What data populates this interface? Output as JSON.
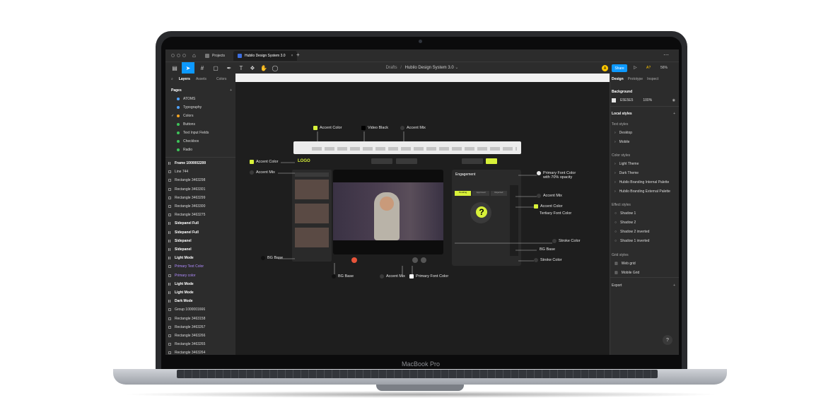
{
  "device": {
    "brand_label": "MacBook Pro"
  },
  "browser": {
    "tabs": [
      {
        "label": "Projects",
        "active": false
      },
      {
        "label": "Hubilo Design System 3.0",
        "active": true
      }
    ]
  },
  "toolbar": {
    "breadcrumb_parent": "Drafts",
    "breadcrumb_separator": "/",
    "file_title": "Hubilo Design System 3.0",
    "avatar_initial": "A",
    "share_label": "Share",
    "ai_label": "A?",
    "zoom": "56%"
  },
  "left_panel": {
    "tabs": [
      "Layers",
      "Assets",
      "Colors"
    ],
    "pages_title": "Pages",
    "pages": [
      {
        "label": "ATOMS",
        "dot": "#4fa3ff"
      },
      {
        "label": "Typography",
        "dot": "#4fa3ff"
      },
      {
        "label": "Colors",
        "dot": "#f6a623",
        "current": true
      },
      {
        "label": "Buttons",
        "dot": "#3ec45a"
      },
      {
        "label": "Text Input Fields",
        "dot": "#3ec45a"
      },
      {
        "label": "Checkbox",
        "dot": "#3ec45a"
      },
      {
        "label": "Radio",
        "dot": "#3ec45a"
      }
    ],
    "layers": [
      {
        "label": "Frame 1000002200",
        "bold": true
      },
      {
        "label": "Line 744"
      },
      {
        "label": "Rectangle 3463298"
      },
      {
        "label": "Rectangle 3463301"
      },
      {
        "label": "Rectangle 3463299"
      },
      {
        "label": "Rectangle 3463300"
      },
      {
        "label": "Rectangle 3463275"
      },
      {
        "label": "Sidepanel Full",
        "bold": true
      },
      {
        "label": "Sidepanel Full",
        "bold": true
      },
      {
        "label": "Sidepanel",
        "bold": true
      },
      {
        "label": "Sidepanel",
        "bold": true
      },
      {
        "label": "Light Mode",
        "bold": true
      },
      {
        "label": "Primary Text Color",
        "purple": true
      },
      {
        "label": "Primary color",
        "purple": true
      },
      {
        "label": "Light Mode",
        "bold": true
      },
      {
        "label": "Light Mode",
        "bold": true
      },
      {
        "label": "Dark Mode",
        "bold": true
      },
      {
        "label": "Group 1000001666"
      },
      {
        "label": "Rectangle 3463158"
      },
      {
        "label": "Rectangle 3463267"
      },
      {
        "label": "Rectangle 3463266"
      },
      {
        "label": "Rectangle 3463265"
      },
      {
        "label": "Rectangle 3463264"
      }
    ]
  },
  "right_panel": {
    "tabs": [
      "Design",
      "Prototype",
      "Inspect"
    ],
    "background_title": "Background",
    "background_hex": "E5E5E5",
    "background_opacity": "100%",
    "local_styles_title": "Local styles",
    "text_styles_title": "Text styles",
    "text_styles": [
      "Desktop",
      "Mobile"
    ],
    "color_styles_title": "Color styles",
    "color_styles": [
      "Light Theme",
      "Dark Theme",
      "Hubilo Branding Internal Palette",
      "Hubilo Branding External Palette"
    ],
    "effect_styles_title": "Effect styles",
    "effect_styles": [
      "Shadow 1",
      "Shadow 2",
      "Shadow 2 inverted",
      "Shadow 1 inverted"
    ],
    "grid_styles_title": "Grid styles",
    "grid_styles": [
      "Web grid",
      "Mobile Grid"
    ],
    "export_title": "Export",
    "help_label": "?"
  },
  "canvas": {
    "annotations": {
      "accent_color_top": "Accent Color",
      "video_black": "Video Black",
      "accent_mix_top": "Accent Mix",
      "accent_color_left": "Accent Color",
      "accent_mix_left": "Accent Mix",
      "primary_font_color": "Primary Font Color",
      "primary_font_opacity": "with 70% opacity",
      "accent_mix_right": "Accent Mix",
      "accent_color_right": "Accent Color",
      "tertiary_font_color": "Tertiary Font Color",
      "stroke_color_1": "Stroke Color",
      "bg_base_right": "BG Base",
      "stroke_color_2": "Stroke Color",
      "bg_base_left": "BG Base",
      "bg_base_bottom": "BG Base",
      "accent_mix_bottom": "Accent Mix",
      "primary_font_color_bottom": "Primary Font Color"
    },
    "mock": {
      "logo": "LOGO",
      "engagement_title": "Engagement",
      "tabs": [
        "Pending",
        "Approved",
        "Rejected"
      ]
    },
    "colors": {
      "accent": "#d8f139",
      "video_black": "#000000",
      "accent_mix": "#3a3a3a",
      "primary_font": "#ffffff"
    }
  }
}
